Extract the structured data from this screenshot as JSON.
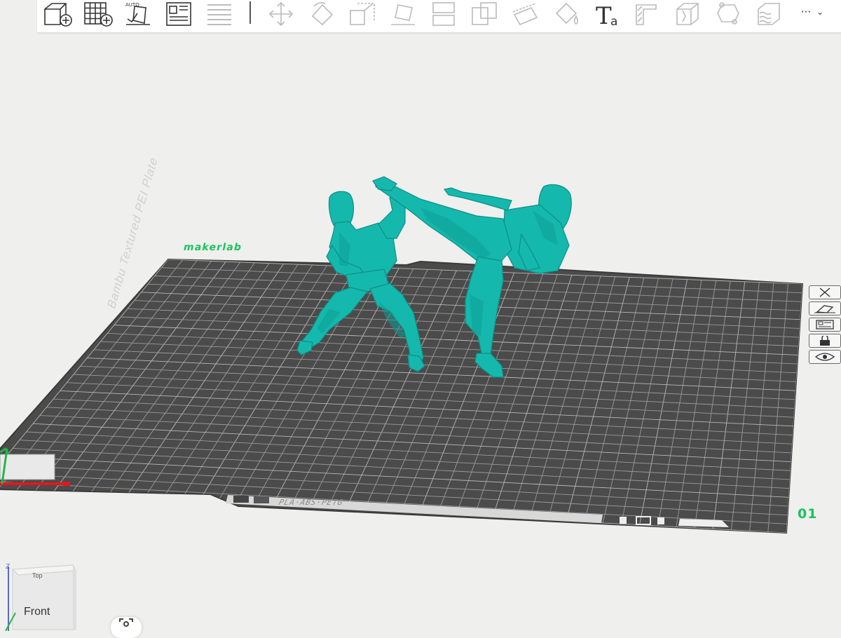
{
  "toolbar": {
    "buttons": [
      {
        "name": "add-object",
        "icon": "add-cube-icon"
      },
      {
        "name": "add-plate",
        "icon": "add-plate-icon"
      },
      {
        "name": "auto-orient",
        "icon": "auto-orient-icon",
        "label": "AUTO"
      },
      {
        "name": "arrange",
        "icon": "arrange-layout-icon"
      },
      {
        "name": "split-layers",
        "icon": "layers-icon"
      },
      {
        "name": "move",
        "icon": "move-arrows-icon"
      },
      {
        "name": "rotate",
        "icon": "rotate-icon"
      },
      {
        "name": "scale",
        "icon": "scale-icon"
      },
      {
        "name": "lay-on-face",
        "icon": "lay-on-face-icon"
      },
      {
        "name": "split",
        "icon": "split-icon"
      },
      {
        "name": "boolean",
        "icon": "boolean-icon"
      },
      {
        "name": "cut",
        "icon": "cut-icon"
      },
      {
        "name": "paint",
        "icon": "paint-bucket-icon"
      },
      {
        "name": "text",
        "icon": "text-tool-icon",
        "label": "T",
        "sublabel": "a"
      },
      {
        "name": "support-paint",
        "icon": "support-paint-icon"
      },
      {
        "name": "seam-paint",
        "icon": "seam-paint-icon"
      },
      {
        "name": "measure",
        "icon": "measure-icon"
      },
      {
        "name": "assembly",
        "icon": "assembly-icon"
      },
      {
        "name": "fuzzy-skin",
        "icon": "fuzzy-skin-icon"
      }
    ],
    "more_label": "···",
    "more_icon": "chevron-down-icon"
  },
  "plate": {
    "brand": "makerlab",
    "number": "01",
    "bed_type": "Bambu Textured PEI Plate",
    "bed_label": "PLA·ABS·PETG"
  },
  "side_buttons": [
    {
      "name": "delete-plate",
      "icon": "close-icon"
    },
    {
      "name": "orient-plate",
      "icon": "orient-icon"
    },
    {
      "name": "arrange-plate",
      "icon": "arrange-icon"
    },
    {
      "name": "lock-plate",
      "icon": "lock-icon"
    },
    {
      "name": "plate-settings",
      "icon": "eye-icon"
    }
  ],
  "nav_cube": {
    "top_label": "Top",
    "front_label": "Front",
    "axis_label": "Z"
  },
  "colors": {
    "model": "#15b8ad",
    "bed": "#4b4b4b",
    "accent": "#19c45b",
    "x_axis": "#e3161b",
    "y_axis": "#25b54a",
    "z_axis": "#5a6abf"
  }
}
